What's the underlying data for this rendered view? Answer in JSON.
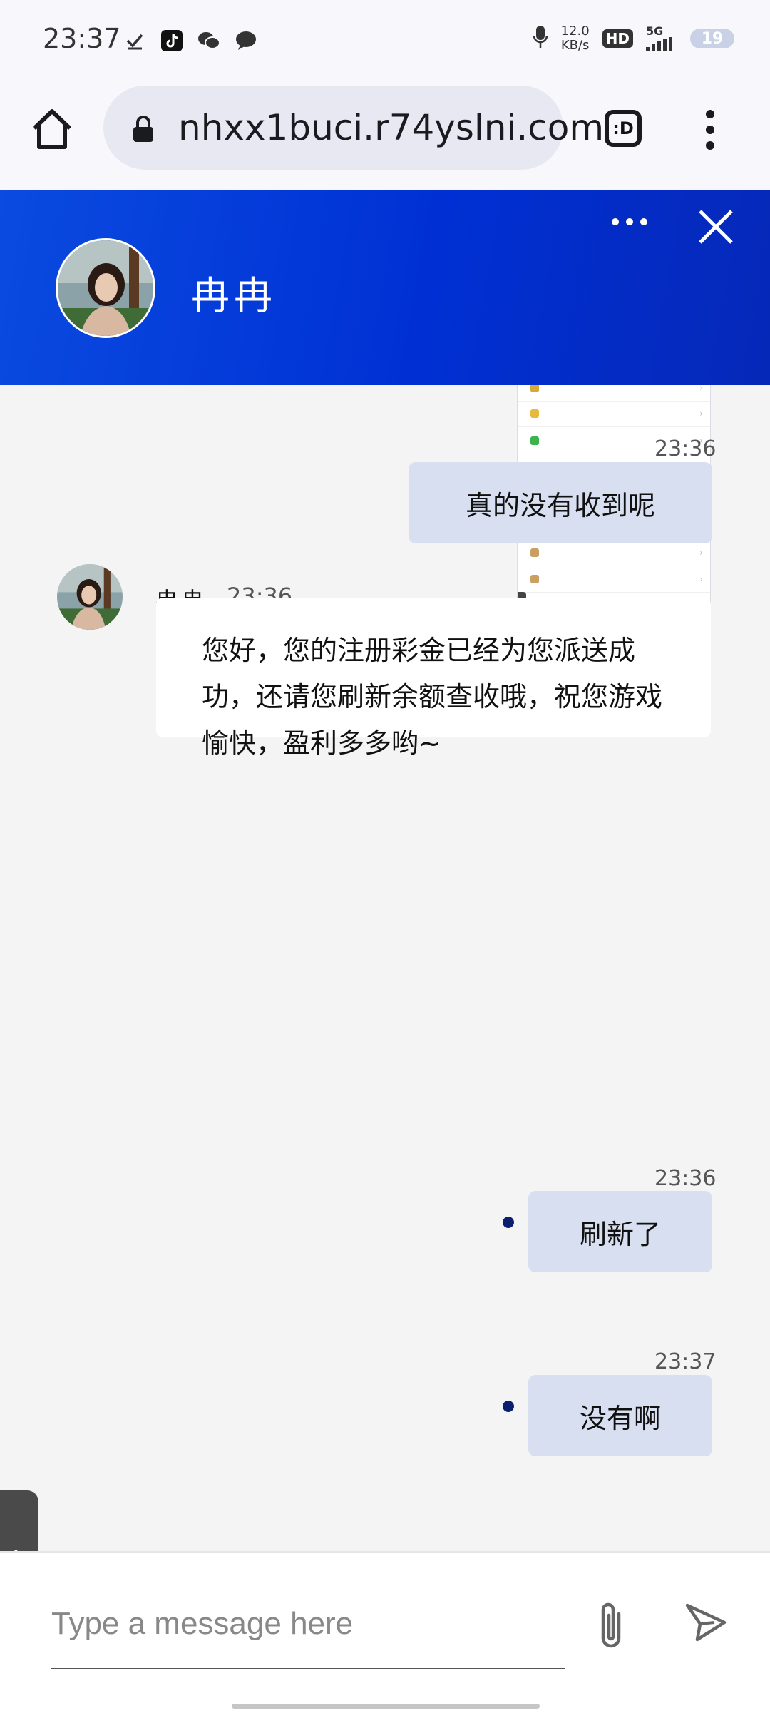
{
  "status_bar": {
    "time": "23:37",
    "left_icons": [
      "check-icon",
      "tiktok-icon",
      "wechat-icon",
      "message-icon"
    ],
    "net_speed_value": "12.0",
    "net_speed_unit": "KB/s",
    "hd_label": "HD",
    "signal_label": "5G",
    "battery_level": "19"
  },
  "browser": {
    "url": "nhxx1buci.r74yslni.com",
    "tab_label": ":D"
  },
  "chat_header": {
    "agent_name": "冉冉",
    "accent_color": "#0038d8"
  },
  "messages": [
    {
      "type": "image",
      "direction": "out"
    },
    {
      "direction": "out",
      "time": "23:36",
      "text": "真的没有收到呢"
    },
    {
      "direction": "in",
      "sender": "冉冉",
      "time": "23:36",
      "text": "您好，您的注册彩金已经为您派送成功，还请您刷新余额查收哦，祝您游戏愉快，盈利多多哟~"
    },
    {
      "direction": "out",
      "time": "23:36",
      "text": "刷新了",
      "unread": true
    },
    {
      "direction": "out",
      "time": "23:37",
      "text": "没有啊",
      "unread": true
    }
  ],
  "composer": {
    "placeholder": "Type a message here"
  }
}
